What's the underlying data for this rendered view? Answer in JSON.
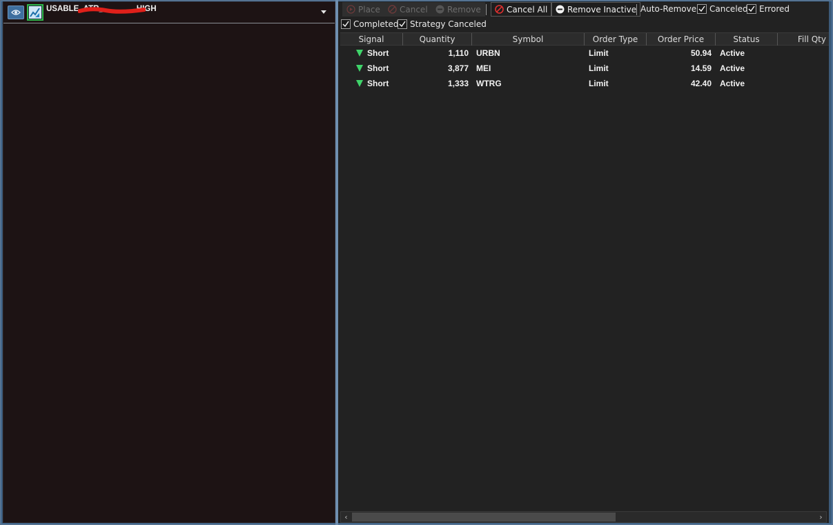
{
  "strategy": {
    "name": "USABLE_ATR_             _HIGH",
    "icon": "strategy-chart-icon",
    "visibility_icon": "eye-icon"
  },
  "toolbar": {
    "place_label": "Place",
    "cancel_label": "Cancel",
    "remove_label": "Remove",
    "cancel_all_label": "Cancel All",
    "remove_inactive_label": "Remove Inactive",
    "auto_remove_label": "Auto-Remove:",
    "checkboxes": [
      {
        "label": "Canceled",
        "checked": true
      },
      {
        "label": "Errored",
        "checked": true
      },
      {
        "label": "Completed",
        "checked": true
      },
      {
        "label": "Strategy Canceled",
        "checked": true
      }
    ]
  },
  "grid": {
    "columns": [
      "Signal",
      "Quantity",
      "Symbol",
      "Order Type",
      "Order Price",
      "Status",
      "Fill Qty"
    ],
    "rows": [
      {
        "signal": "Short",
        "quantity": "1,110",
        "symbol": "URBN",
        "order_type": "Limit",
        "order_price": "50.94",
        "status": "Active"
      },
      {
        "signal": "Short",
        "quantity": "3,877",
        "symbol": "MEI",
        "order_type": "Limit",
        "order_price": "14.59",
        "status": "Active"
      },
      {
        "signal": "Short",
        "quantity": "1,333",
        "symbol": "WTRG",
        "order_type": "Limit",
        "order_price": "42.40",
        "status": "Active"
      }
    ]
  },
  "colors": {
    "signal_short": "#3fd46a",
    "cancel_red": "#d83a3a",
    "strategy_border": "#2fb84b"
  }
}
